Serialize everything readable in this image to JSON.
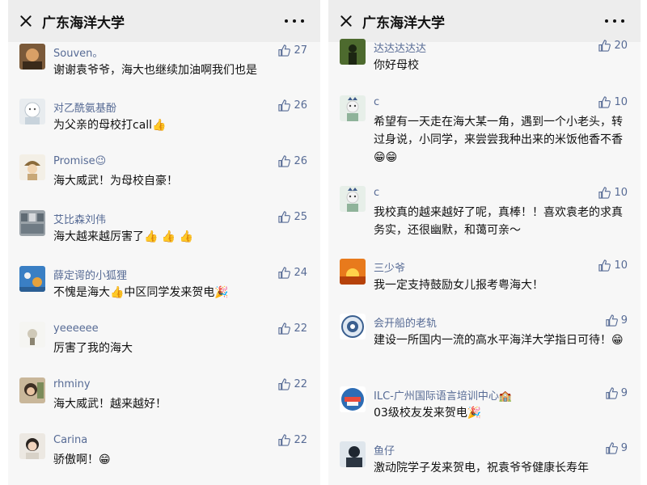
{
  "left": {
    "title": "广东海洋大学",
    "comments": [
      {
        "name": "Souven。",
        "likes": "27",
        "text": "谢谢袁爷爷，海大也继续加油啊我们也是"
      },
      {
        "name": "对乙酰氨基酚",
        "likes": "26",
        "text": "为父亲的母校打call👍"
      },
      {
        "name": "Promise😉",
        "likes": "26",
        "text": "海大威武！为母校自豪！"
      },
      {
        "name": "艾比森刘伟",
        "likes": "25",
        "text": "海大越来越厉害了👍 👍 👍"
      },
      {
        "name": "薛定谔的小狐狸",
        "likes": "24",
        "text": "不愧是海大👍中区同学发来贺电🎉"
      },
      {
        "name": "yeeeeee",
        "likes": "22",
        "text": "厉害了我的海大"
      },
      {
        "name": "rhminy",
        "likes": "22",
        "text": "海大威武！越来越好！"
      },
      {
        "name": "Carina",
        "likes": "22",
        "text": "骄傲啊！😁"
      }
    ]
  },
  "right": {
    "title": "广东海洋大学",
    "comments": [
      {
        "name": "达达达达达",
        "likes": "20",
        "text": "你好母校"
      },
      {
        "name": "c",
        "likes": "10",
        "text": "希望有一天走在海大某一角，遇到一个小老头，转过身说，小同学，来尝尝我种出来的米饭他香不香😁😁"
      },
      {
        "name": "c",
        "likes": "10",
        "text": "我校真的越来越好了呢，真棒！！喜欢袁老的求真务实，还很幽默，和蔼可亲～"
      },
      {
        "name": "三少爷",
        "likes": "10",
        "text": "我一定支持鼓励女儿报考粤海大！"
      },
      {
        "name": "会开船的老轨",
        "likes": "9",
        "text": "建设一所国内一流的高水平海洋大学指日可待！😁"
      },
      {
        "name": "ILC-广州国际语言培训中心🏫",
        "likes": "9",
        "text": "03级校友发来贺电🎉"
      },
      {
        "name": "鱼仔",
        "likes": "9",
        "text": "激动院学子发来贺电，祝袁爷爷健康长寿年"
      }
    ]
  },
  "colors": {
    "name": "#576b95",
    "bg": "#ededed",
    "list_bg": "#f7f7f7"
  }
}
